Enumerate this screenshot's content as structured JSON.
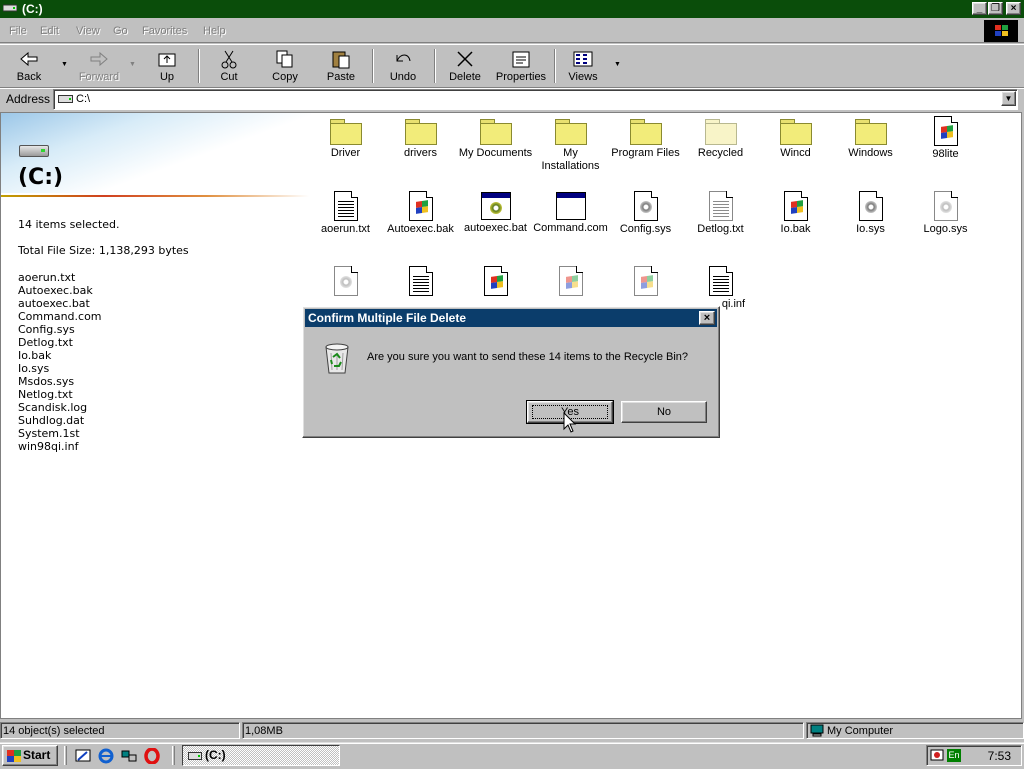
{
  "window": {
    "title": "(C:)",
    "controls": {
      "minimize": "_",
      "maximize": "❐",
      "close": "×"
    }
  },
  "menu": [
    "File",
    "Edit",
    "View",
    "Go",
    "Favorites",
    "Help"
  ],
  "toolbar": {
    "back": "Back",
    "forward": "Forward",
    "up": "Up",
    "cut": "Cut",
    "copy": "Copy",
    "paste": "Paste",
    "undo": "Undo",
    "delete": "Delete",
    "properties": "Properties",
    "views": "Views"
  },
  "address": {
    "label": "Address",
    "value": "C:\\"
  },
  "left_pane": {
    "drive_title": "(C:)",
    "selected_text": "14 items selected.",
    "total_size_text": "Total File Size: 1,138,293 bytes",
    "files": [
      "aoerun.txt",
      "Autoexec.bak",
      "autoexec.bat",
      "Command.com",
      "Config.sys",
      "Detlog.txt",
      "Io.bak",
      "Io.sys",
      "Msdos.sys",
      "Netlog.txt",
      "Scandisk.log",
      "Suhdlog.dat",
      "System.1st",
      "win98qi.inf"
    ]
  },
  "icons_row1": [
    {
      "label": "Driver",
      "type": "folder"
    },
    {
      "label": "drivers",
      "type": "folder"
    },
    {
      "label": "My Documents",
      "type": "folder"
    },
    {
      "label": "My Installations",
      "type": "folder"
    },
    {
      "label": "Program Files",
      "type": "folder"
    },
    {
      "label": "Recycled",
      "type": "folder-light"
    },
    {
      "label": "Wincd",
      "type": "folder"
    },
    {
      "label": "Windows",
      "type": "folder"
    },
    {
      "label": "98lite",
      "type": "doc-win"
    }
  ],
  "icons_row2": [
    {
      "label": "aoerun.txt",
      "type": "doc-text"
    },
    {
      "label": "Autoexec.bak",
      "type": "doc-win"
    },
    {
      "label": "autoexec.bat",
      "type": "win32-gear"
    },
    {
      "label": "Command.com",
      "type": "win32"
    },
    {
      "label": "Config.sys",
      "type": "doc-gear"
    },
    {
      "label": "Detlog.txt",
      "type": "doc-text"
    },
    {
      "label": "Io.bak",
      "type": "doc-win"
    },
    {
      "label": "Io.sys",
      "type": "doc-gear"
    },
    {
      "label": "Logo.sys",
      "type": "doc-gear"
    }
  ],
  "icons_row3": [
    {
      "label": "",
      "type": "doc-gear"
    },
    {
      "label": "",
      "type": "doc-text"
    },
    {
      "label": "",
      "type": "doc-win"
    },
    {
      "label": "",
      "type": "doc-win"
    },
    {
      "label": "",
      "type": "doc-win"
    },
    {
      "label": "qi.inf",
      "type": "doc-text"
    }
  ],
  "dialog": {
    "title": "Confirm Multiple File Delete",
    "message": "Are you sure you want to send these 14 items to the Recycle Bin?",
    "yes": "Yes",
    "no": "No"
  },
  "statusbar": {
    "objects": "14 object(s) selected",
    "size": "1,08MB",
    "zone": "My Computer"
  },
  "taskbar": {
    "start": "Start",
    "task": "(C:)",
    "lang": "En",
    "clock": "7:53"
  }
}
